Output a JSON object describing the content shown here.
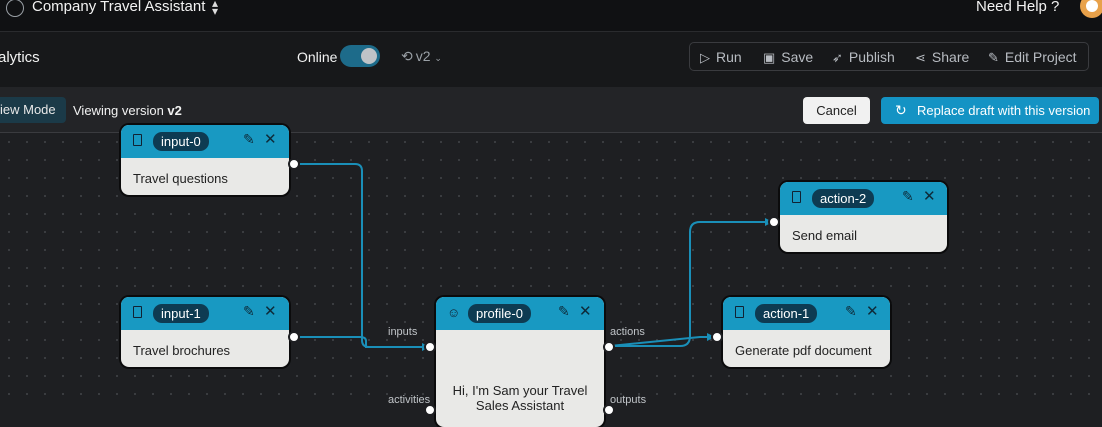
{
  "topbar": {
    "app_title": "Company Travel Assistant",
    "help_label": "Need Help ?"
  },
  "toolbar": {
    "section_title": "alytics",
    "online_label": "Online",
    "version_label": "v2",
    "actions": {
      "run": "Run",
      "save": "Save",
      "publish": "Publish",
      "share": "Share",
      "edit_project": "Edit Project"
    }
  },
  "viewbar": {
    "mode_label": "iew Mode",
    "viewing_prefix": "Viewing version ",
    "viewing_version": "v2",
    "cancel_label": "Cancel",
    "replace_label": "Replace draft with this version"
  },
  "nodes": {
    "input0": {
      "id": "input-0",
      "text": "Travel questions"
    },
    "input1": {
      "id": "input-1",
      "text": "Travel brochures"
    },
    "profile0": {
      "id": "profile-0",
      "text1": "Hi, I'm Sam your Travel",
      "text2": "Sales Assistant"
    },
    "action2": {
      "id": "action-2",
      "text": "Send email"
    },
    "action1": {
      "id": "action-1",
      "text": "Generate pdf document"
    }
  },
  "ports": {
    "inputs": "inputs",
    "actions": "actions",
    "activities": "activities",
    "outputs": "outputs"
  },
  "colors": {
    "accent": "#1493c4",
    "node_header": "#1899c2",
    "edge": "#1a8fb8"
  }
}
